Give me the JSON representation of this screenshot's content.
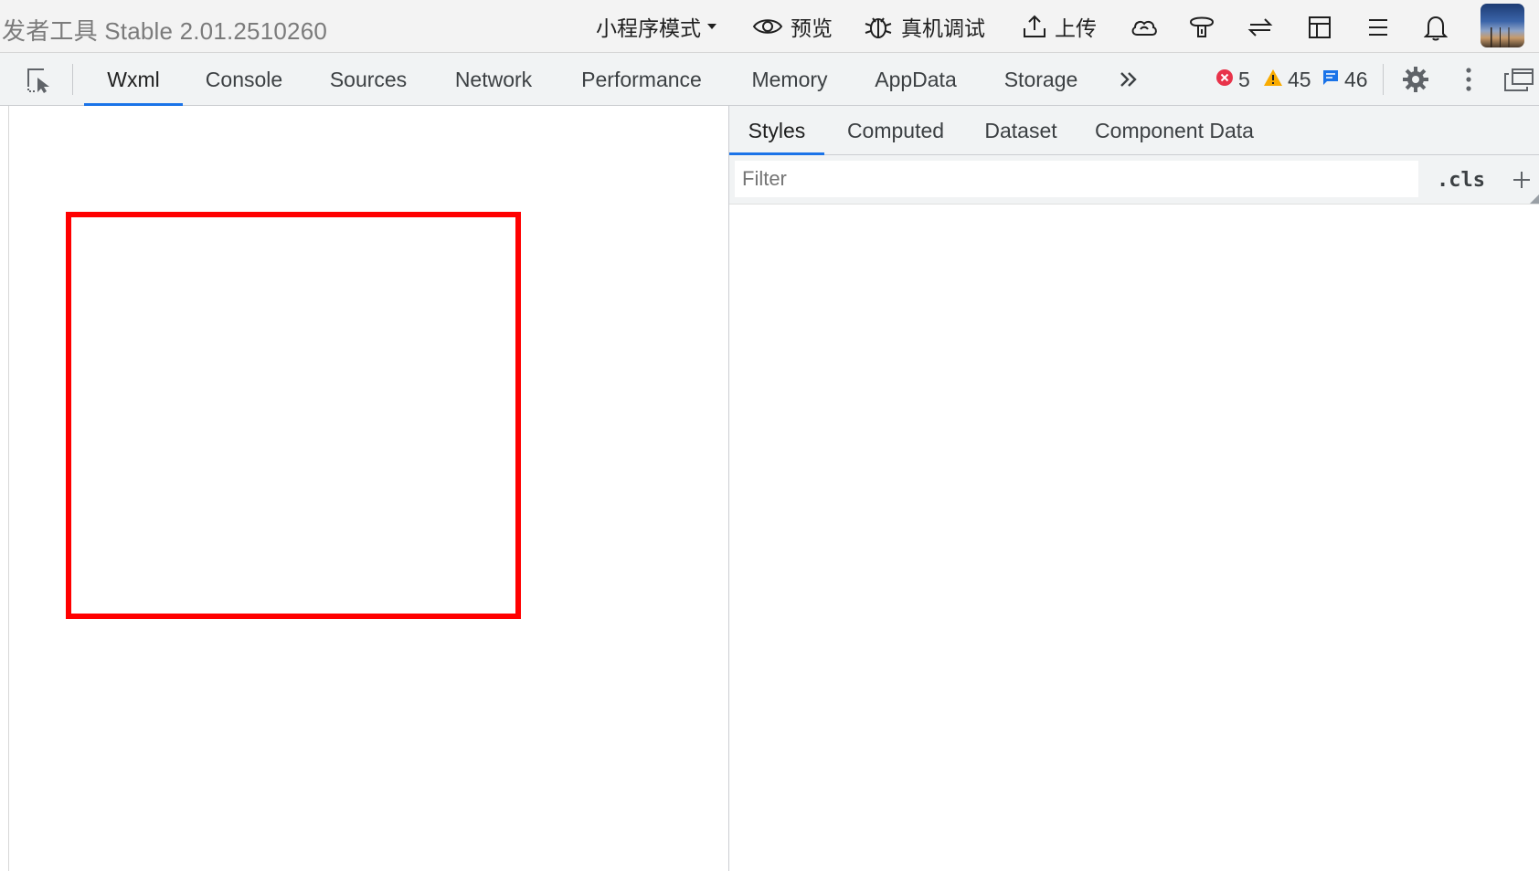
{
  "titlebar": {
    "app_title": "发者工具 Stable 2.01.2510260",
    "mode_label": "小程序模式",
    "preview_label": "预览",
    "debug_label": "真机调试",
    "upload_label": "上传"
  },
  "devtools": {
    "tabs": [
      "Wxml",
      "Console",
      "Sources",
      "Network",
      "Performance",
      "Memory",
      "AppData",
      "Storage"
    ],
    "active_tab": "Wxml",
    "errors": "5",
    "warnings": "45",
    "messages": "46"
  },
  "styles_panel": {
    "tabs": [
      "Styles",
      "Computed",
      "Dataset",
      "Component Data"
    ],
    "active_tab": "Styles",
    "filter_placeholder": "Filter",
    "filter_value": "",
    "cls_label": ".cls"
  },
  "colors": {
    "accent": "#1a73e8",
    "highlight_box": "#ff0000",
    "error": "#e8334a",
    "warning": "#f9ab00",
    "info": "#1a73e8"
  },
  "icons": {
    "titlebar": [
      "eye-icon",
      "bug-icon",
      "upload-icon",
      "cloud-icon",
      "lamp-icon",
      "swap-icon",
      "layout-icon",
      "menu-icon",
      "bell-icon"
    ],
    "devtools": [
      "inspect-icon",
      "more-tabs-icon",
      "error-icon",
      "warning-icon",
      "message-icon",
      "settings-icon",
      "kebab-icon",
      "undock-icon"
    ]
  }
}
